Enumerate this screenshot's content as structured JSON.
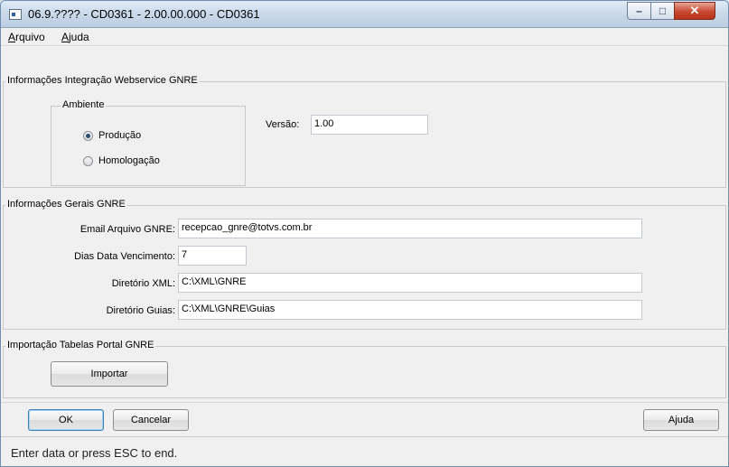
{
  "window": {
    "title": "06.9.???? - CD0361 - 2.00.00.000 - CD0361",
    "min_glyph": "–",
    "max_glyph": "□",
    "close_glyph": "✕"
  },
  "menu": {
    "arquivo": "Arquivo",
    "ajuda": "Ajuda"
  },
  "integracao": {
    "title": "Informações Integração Webservice GNRE",
    "ambiente": {
      "title": "Ambiente",
      "options": [
        "Produção",
        "Homologação"
      ],
      "selected": "Produção"
    },
    "versao_label": "Versão:",
    "versao_value": "1.00"
  },
  "gerais": {
    "title": "Informações Gerais GNRE",
    "email_label": "Email Arquivo GNRE:",
    "email_value": "recepcao_gnre@totvs.com.br",
    "dias_label": "Dias Data Vencimento:",
    "dias_value": "7",
    "xml_label": "Diretório XML:",
    "xml_value": "C:\\XML\\GNRE",
    "guias_label": "Diretório Guias:",
    "guias_value": "C:\\XML\\GNRE\\Guias"
  },
  "importacao": {
    "title": "Importação Tabelas Portal GNRE",
    "button": "Importar"
  },
  "footer": {
    "ok": "OK",
    "cancel": "Cancelar",
    "help": "Ajuda"
  },
  "status": {
    "text": "Enter data or press ESC to end."
  }
}
